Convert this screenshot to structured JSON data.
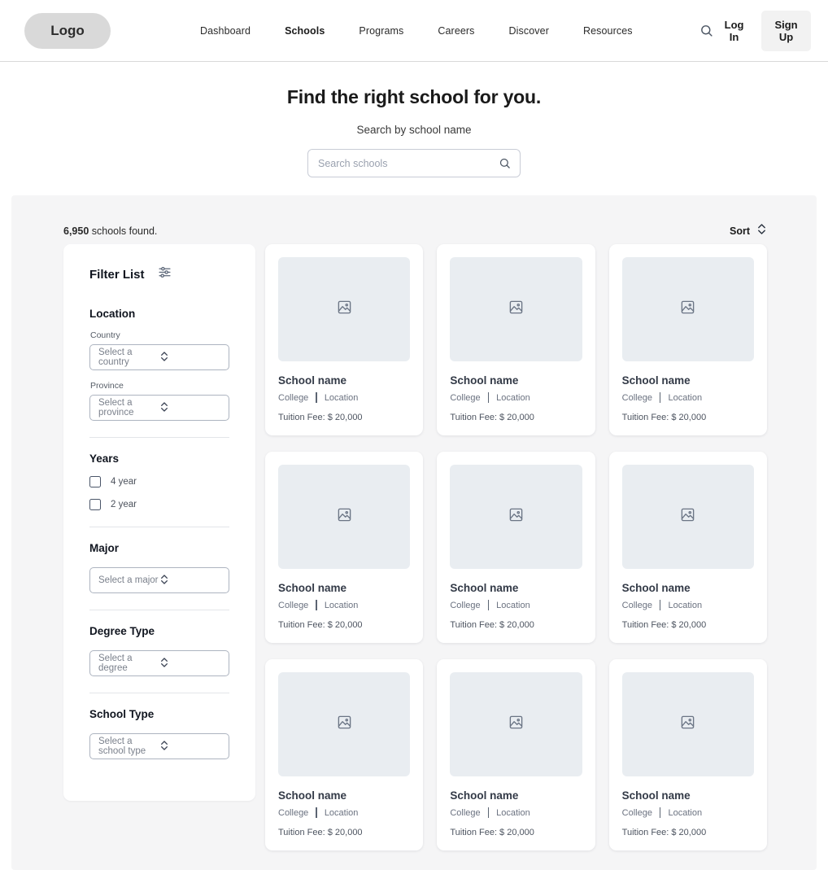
{
  "header": {
    "logo": "Logo",
    "nav": [
      {
        "label": "Dashboard",
        "active": false
      },
      {
        "label": "Schools",
        "active": true
      },
      {
        "label": "Programs",
        "active": false
      },
      {
        "label": "Careers",
        "active": false
      },
      {
        "label": "Discover",
        "active": false
      },
      {
        "label": "Resources",
        "active": false
      }
    ],
    "search_icon": "search-icon",
    "login_label": "Log In",
    "signup_label": "Sign Up"
  },
  "hero": {
    "title": "Find the right school for you.",
    "subtitle": "Search by school name",
    "search_placeholder": "Search schools",
    "search_value": "",
    "search_icon": "search-icon"
  },
  "results": {
    "count": "6,950",
    "count_suffix": " schools found.",
    "sort_label": "Sort",
    "sort_icon": "chevron-up-down-icon"
  },
  "filters": {
    "title": "Filter List",
    "icon": "sliders-icon",
    "location": {
      "heading": "Location",
      "country_label": "Country",
      "country_value": "Select a country",
      "province_label": "Province",
      "province_value": "Select a province"
    },
    "years": {
      "heading": "Years",
      "options": [
        {
          "label": "4 year",
          "checked": false
        },
        {
          "label": "2 year",
          "checked": false
        }
      ]
    },
    "major": {
      "heading": "Major",
      "value": "Select a major"
    },
    "degree": {
      "heading": "Degree Type",
      "value": "Select a degree"
    },
    "school_type": {
      "heading": "School Type",
      "value": "Select a school type"
    }
  },
  "cards": [
    {
      "name": "School name",
      "type": "College",
      "location": "Location",
      "fee": "Tuition Fee: $ 20,000",
      "image_icon": "image-placeholder-icon"
    },
    {
      "name": "School name",
      "type": "College",
      "location": "Location",
      "fee": "Tuition Fee: $ 20,000",
      "image_icon": "image-placeholder-icon"
    },
    {
      "name": "School name",
      "type": "College",
      "location": "Location",
      "fee": "Tuition Fee: $ 20,000",
      "image_icon": "image-placeholder-icon"
    },
    {
      "name": "School name",
      "type": "College",
      "location": "Location",
      "fee": "Tuition Fee: $ 20,000",
      "image_icon": "image-placeholder-icon"
    },
    {
      "name": "School name",
      "type": "College",
      "location": "Location",
      "fee": "Tuition Fee: $ 20,000",
      "image_icon": "image-placeholder-icon"
    },
    {
      "name": "School name",
      "type": "College",
      "location": "Location",
      "fee": "Tuition Fee: $ 20,000",
      "image_icon": "image-placeholder-icon"
    },
    {
      "name": "School name",
      "type": "College",
      "location": "Location",
      "fee": "Tuition Fee: $ 20,000",
      "image_icon": "image-placeholder-icon"
    },
    {
      "name": "School name",
      "type": "College",
      "location": "Location",
      "fee": "Tuition Fee: $ 20,000",
      "image_icon": "image-placeholder-icon"
    },
    {
      "name": "School name",
      "type": "College",
      "location": "Location",
      "fee": "Tuition Fee: $ 20,000",
      "image_icon": "image-placeholder-icon"
    }
  ],
  "colors": {
    "page_bg": "#ffffff",
    "panel_bg": "#f5f5f6",
    "card_bg": "#ffffff",
    "image_placeholder": "#e9edf1",
    "logo_bg": "#d9d9d9",
    "signup_bg": "#f2f2f2",
    "text_dark": "#10151f",
    "text_muted": "#6b7280",
    "border": "#adb4c0"
  }
}
